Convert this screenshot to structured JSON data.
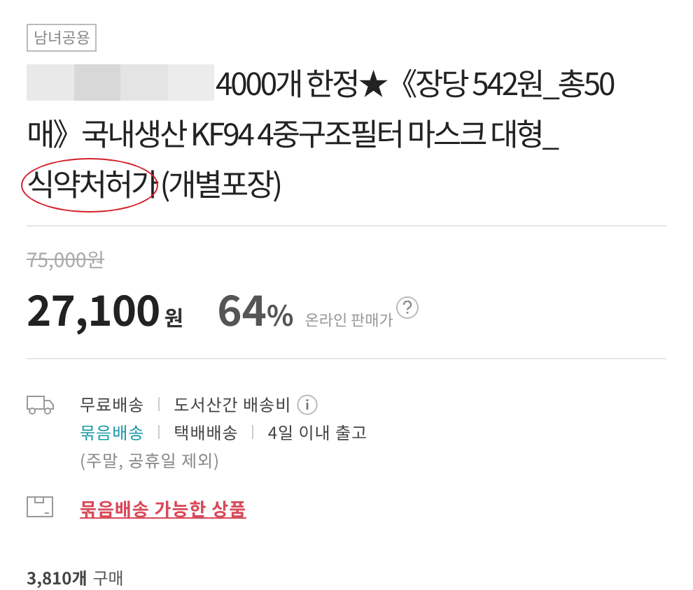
{
  "tag": "남녀공용",
  "title": {
    "redacted": true,
    "lines": [
      [
        {
          "text": "4000개 한정★《장당 542원_총50",
          "circled": false
        }
      ],
      [
        {
          "text": "매》국내생산 KF94 4중구조필터 마스크 대형_",
          "circled": false
        }
      ],
      [
        {
          "text": "식약처허가",
          "circled": true
        },
        {
          "text": "(개별포장)",
          "circled": false
        }
      ]
    ]
  },
  "price": {
    "original": "75,000원",
    "amount": "27,100",
    "unit": "원",
    "discount": "64",
    "percent": "%",
    "label": "온라인 판매가"
  },
  "delivery": {
    "rows": [
      [
        {
          "text": "무료배송",
          "highlight": false
        },
        {
          "text": "도서산간 배송비",
          "highlight": false,
          "info": true
        }
      ],
      [
        {
          "text": "묶음배송",
          "highlight": true
        },
        {
          "text": "택배배송",
          "highlight": false
        },
        {
          "text": "4일 이내 출고",
          "highlight": false
        }
      ]
    ],
    "note": "(주말, 공휴일 제외)",
    "bundle_link": "묶음배송 가능한 상품"
  },
  "purchases": {
    "count": "3,810개",
    "label": "구매"
  }
}
